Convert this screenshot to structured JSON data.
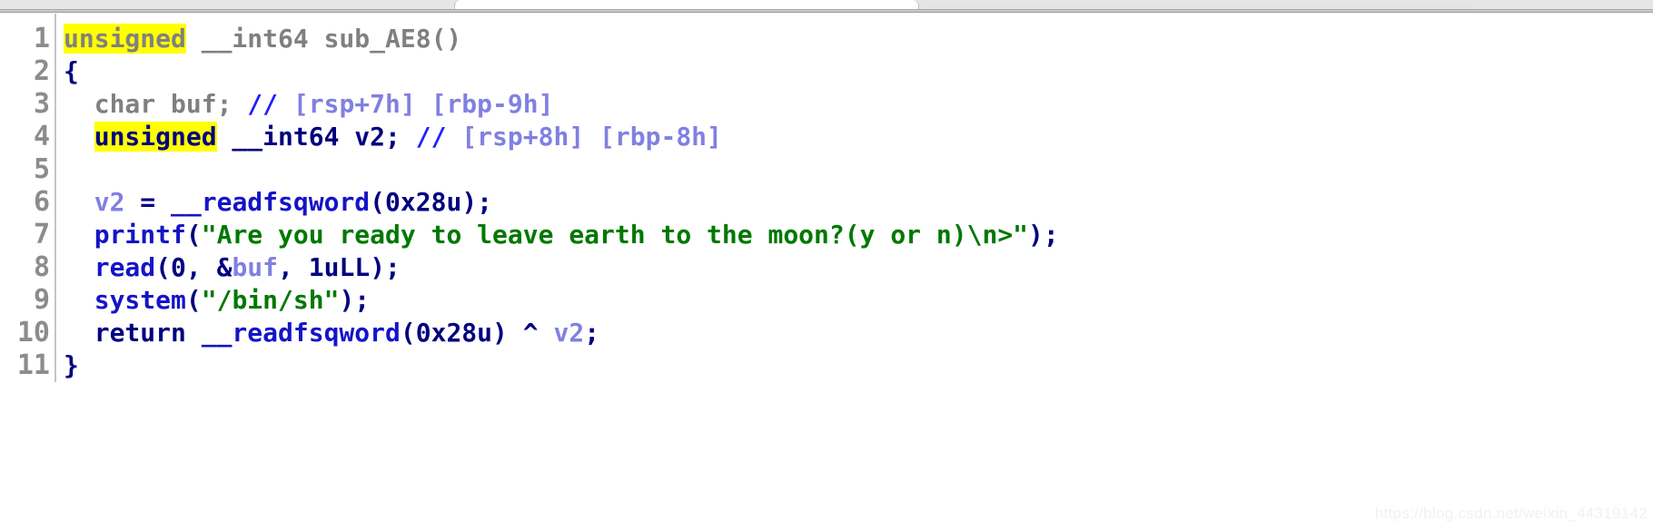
{
  "window": {
    "chrome_tabs": [
      "",
      ""
    ]
  },
  "editor": {
    "name": "ida-pseudocode-view",
    "gutter_numbers": [
      "1",
      "2",
      "3",
      "4",
      "5",
      "6",
      "7",
      "8",
      "9",
      "10",
      "11"
    ],
    "colors": {
      "plain": "#808080",
      "keyword": "#000080",
      "function": "#1414c8",
      "variable": "#8080e0",
      "comment_slashes": "#2020ff",
      "comment_text": "#8080e0",
      "string": "#007800",
      "highlight": "#ffff00",
      "background": "#ffffff",
      "gutter_text": "#8c8c8c"
    },
    "lines": [
      {
        "number": "1",
        "tokens": [
          {
            "text": "unsigned",
            "cls": "t-plain hl"
          },
          {
            "text": " __int64 sub_AE8()",
            "cls": "t-plain"
          }
        ]
      },
      {
        "number": "2",
        "tokens": [
          {
            "text": "{",
            "cls": "t-kw"
          }
        ]
      },
      {
        "number": "3",
        "tokens": [
          {
            "text": "  char buf; ",
            "cls": "t-plain"
          },
          {
            "text": "//",
            "cls": "t-cmt"
          },
          {
            "text": " [rsp+7h] [rbp-9h]",
            "cls": "t-cmttxt"
          }
        ]
      },
      {
        "number": "4",
        "tokens": [
          {
            "text": "  ",
            "cls": "t-kw"
          },
          {
            "text": "unsigned",
            "cls": "t-kw hl"
          },
          {
            "text": " __int64 v2; ",
            "cls": "t-kw"
          },
          {
            "text": "//",
            "cls": "t-cmt"
          },
          {
            "text": " [rsp+8h] [rbp-8h]",
            "cls": "t-cmttxt"
          }
        ]
      },
      {
        "number": "5",
        "tokens": [
          {
            "text": "",
            "cls": "t-plain"
          }
        ]
      },
      {
        "number": "6",
        "tokens": [
          {
            "text": "  ",
            "cls": "t-kw"
          },
          {
            "text": "v2",
            "cls": "t-var"
          },
          {
            "text": " = ",
            "cls": "t-kw"
          },
          {
            "text": "__readfsqword",
            "cls": "t-fn"
          },
          {
            "text": "(",
            "cls": "t-kw"
          },
          {
            "text": "0x28u",
            "cls": "t-num"
          },
          {
            "text": ");",
            "cls": "t-kw"
          }
        ]
      },
      {
        "number": "7",
        "tokens": [
          {
            "text": "  ",
            "cls": "t-kw"
          },
          {
            "text": "printf",
            "cls": "t-fn"
          },
          {
            "text": "(",
            "cls": "t-kw"
          },
          {
            "text": "\"Are you ready to leave earth to the moon?(y or n)\\n>\"",
            "cls": "t-str"
          },
          {
            "text": ");",
            "cls": "t-kw"
          }
        ]
      },
      {
        "number": "8",
        "tokens": [
          {
            "text": "  ",
            "cls": "t-kw"
          },
          {
            "text": "read",
            "cls": "t-fn"
          },
          {
            "text": "(",
            "cls": "t-kw"
          },
          {
            "text": "0",
            "cls": "t-num"
          },
          {
            "text": ", &",
            "cls": "t-kw"
          },
          {
            "text": "buf",
            "cls": "t-var"
          },
          {
            "text": ", ",
            "cls": "t-kw"
          },
          {
            "text": "1uLL",
            "cls": "t-kw"
          },
          {
            "text": ");",
            "cls": "t-kw"
          }
        ]
      },
      {
        "number": "9",
        "tokens": [
          {
            "text": "  ",
            "cls": "t-kw"
          },
          {
            "text": "system",
            "cls": "t-fn"
          },
          {
            "text": "(",
            "cls": "t-kw"
          },
          {
            "text": "\"/bin/sh\"",
            "cls": "t-str"
          },
          {
            "text": ");",
            "cls": "t-kw"
          }
        ]
      },
      {
        "number": "10",
        "tokens": [
          {
            "text": "  return ",
            "cls": "t-kw"
          },
          {
            "text": "__readfsqword",
            "cls": "t-fn"
          },
          {
            "text": "(",
            "cls": "t-kw"
          },
          {
            "text": "0x28u",
            "cls": "t-num"
          },
          {
            "text": ") ^ ",
            "cls": "t-kw"
          },
          {
            "text": "v2",
            "cls": "t-var"
          },
          {
            "text": ";",
            "cls": "t-kw"
          }
        ]
      },
      {
        "number": "11",
        "tokens": [
          {
            "text": "}",
            "cls": "t-kw"
          }
        ]
      }
    ]
  },
  "watermark": {
    "text": "https://blog.csdn.net/weixin_44319142"
  }
}
